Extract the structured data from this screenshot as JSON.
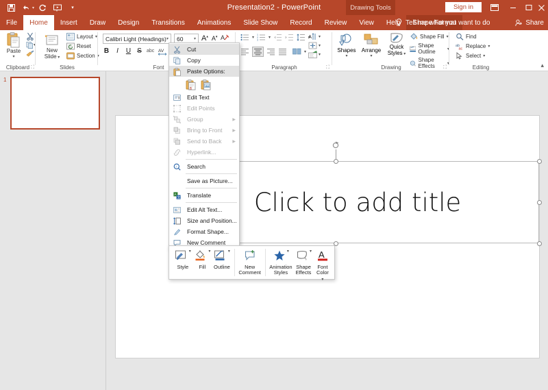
{
  "window": {
    "title": "Presentation2  -  PowerPoint",
    "contextual_tab_group": "Drawing Tools",
    "signin_label": "Sign in",
    "accent_color": "#b7472a",
    "contextual_tab_bg": "#a23b1f",
    "quick_access": [
      {
        "name": "save-icon",
        "glyph": "⬚"
      },
      {
        "name": "undo-icon",
        "glyph": "↶"
      },
      {
        "name": "redo-icon",
        "glyph": "↻"
      },
      {
        "name": "start-from-beginning-icon",
        "glyph": "⬜"
      },
      {
        "name": "customize-qat-icon",
        "glyph": "⌄"
      }
    ],
    "controls": {
      "ribbon_display": "⬒",
      "minimize": "–",
      "maximize": "☐",
      "close": "✕"
    }
  },
  "tabs": [
    {
      "label": "File",
      "active": false,
      "contextual": false
    },
    {
      "label": "Home",
      "active": true,
      "contextual": false
    },
    {
      "label": "Insert",
      "active": false,
      "contextual": false
    },
    {
      "label": "Draw",
      "active": false,
      "contextual": false
    },
    {
      "label": "Design",
      "active": false,
      "contextual": false
    },
    {
      "label": "Transitions",
      "active": false,
      "contextual": false
    },
    {
      "label": "Animations",
      "active": false,
      "contextual": false
    },
    {
      "label": "Slide Show",
      "active": false,
      "contextual": false
    },
    {
      "label": "Record",
      "active": false,
      "contextual": false
    },
    {
      "label": "Review",
      "active": false,
      "contextual": false
    },
    {
      "label": "View",
      "active": false,
      "contextual": false
    },
    {
      "label": "Help",
      "active": false,
      "contextual": false
    },
    {
      "label": "Shape Format",
      "active": false,
      "contextual": true
    }
  ],
  "tellme": {
    "label": "Tell me what you want to do",
    "icon": "lightbulb-icon"
  },
  "share": {
    "label": "Share",
    "icon": "share-person-icon"
  },
  "ribbon": {
    "groups": [
      {
        "name": "Clipboard"
      },
      {
        "name": "Slides"
      },
      {
        "name": "Font"
      },
      {
        "name": "Paragraph"
      },
      {
        "name": "Drawing"
      },
      {
        "name": "Editing"
      }
    ],
    "clipboard": {
      "paste_label": "Paste",
      "cut_tooltip": "Cut",
      "copy_tooltip": "Copy",
      "format_painter_tooltip": "Format Painter"
    },
    "slides": {
      "new_slide_label": "New\nSlide",
      "new_slide_line1": "New",
      "new_slide_line2": "Slide",
      "layout_label": "Layout",
      "reset_label": "Reset",
      "section_label": "Section"
    },
    "font": {
      "font_name": "Calibri Light (Headings)",
      "font_size": "60",
      "bold": "B",
      "italic": "I",
      "underline": "U",
      "strikethrough": "S",
      "shadow": "abc",
      "char_spacing": "AV",
      "grow_font": "A",
      "shrink_font": "A",
      "clear_formatting": "A"
    },
    "drawing": {
      "shapes_label": "Shapes",
      "arrange_label": "Arrange",
      "quick_styles_line1": "Quick",
      "quick_styles_line2": "Styles",
      "shape_fill_label": "Shape Fill",
      "shape_outline_label": "Shape Outline",
      "shape_effects_label": "Shape Effects"
    },
    "editing": {
      "find_label": "Find",
      "replace_label": "Replace",
      "select_label": "Select"
    }
  },
  "thumbnails": [
    {
      "number": "1"
    }
  ],
  "slide": {
    "title_placeholder": "Click to add title"
  },
  "context_menu": {
    "items": [
      {
        "label": "Cut",
        "icon": "scissors-icon",
        "disabled": false,
        "highlighted": true,
        "submenu": false,
        "separator_after": false
      },
      {
        "label": "Copy",
        "icon": "copy-icon",
        "disabled": false,
        "highlighted": false,
        "submenu": false,
        "separator_after": false
      },
      {
        "label": "Paste Options:",
        "icon": "paste-icon",
        "disabled": false,
        "highlighted": true,
        "submenu": false,
        "separator_after": false
      },
      {
        "label": "Edit Text",
        "icon": "edit-text-icon",
        "disabled": false,
        "highlighted": false,
        "submenu": false,
        "separator_after": false
      },
      {
        "label": "Edit Points",
        "icon": "edit-points-icon",
        "disabled": true,
        "highlighted": false,
        "submenu": false,
        "separator_after": false
      },
      {
        "label": "Group",
        "icon": "group-icon",
        "disabled": true,
        "highlighted": false,
        "submenu": true,
        "separator_after": false
      },
      {
        "label": "Bring to Front",
        "icon": "bring-to-front-icon",
        "disabled": true,
        "highlighted": false,
        "submenu": true,
        "separator_after": false
      },
      {
        "label": "Send to Back",
        "icon": "send-to-back-icon",
        "disabled": true,
        "highlighted": false,
        "submenu": true,
        "separator_after": false
      },
      {
        "label": "Hyperlink...",
        "icon": "hyperlink-icon",
        "disabled": true,
        "highlighted": false,
        "submenu": false,
        "separator_after": true
      },
      {
        "label": "Search",
        "icon": "search-icon",
        "disabled": false,
        "highlighted": false,
        "submenu": false,
        "separator_after": true
      },
      {
        "label": "Save as Picture...",
        "icon": "save-as-picture-icon",
        "disabled": false,
        "highlighted": false,
        "submenu": false,
        "separator_after": true
      },
      {
        "label": "Translate",
        "icon": "translate-icon",
        "disabled": false,
        "highlighted": false,
        "submenu": false,
        "separator_after": true
      },
      {
        "label": "Edit Alt Text...",
        "icon": "alt-text-icon",
        "disabled": false,
        "highlighted": false,
        "submenu": false,
        "separator_after": false
      },
      {
        "label": "Size and Position...",
        "icon": "size-position-icon",
        "disabled": false,
        "highlighted": false,
        "submenu": false,
        "separator_after": false
      },
      {
        "label": "Format Shape...",
        "icon": "format-shape-icon",
        "disabled": false,
        "highlighted": false,
        "submenu": false,
        "separator_after": false
      },
      {
        "label": "New Comment",
        "icon": "new-comment-icon",
        "disabled": false,
        "highlighted": false,
        "submenu": false,
        "separator_after": false
      }
    ],
    "paste_options": [
      {
        "name": "paste-keep-text-only-icon"
      },
      {
        "name": "paste-picture-icon"
      }
    ]
  },
  "mini_toolbar": {
    "items": [
      {
        "label1": "Style",
        "label2": "",
        "icon": "shape-style-icon",
        "dropdown": true
      },
      {
        "label1": "Fill",
        "label2": "",
        "icon": "fill-bucket-icon",
        "dropdown": true
      },
      {
        "label1": "Outline",
        "label2": "",
        "icon": "outline-pen-icon",
        "dropdown": true
      },
      {
        "label1": "New",
        "label2": "Comment",
        "icon": "new-comment-icon",
        "dropdown": false
      },
      {
        "label1": "Animation",
        "label2": "Styles",
        "icon": "animation-star-icon",
        "dropdown": true
      },
      {
        "label1": "Shape",
        "label2": "Effects",
        "icon": "shape-effects-icon",
        "dropdown": true
      },
      {
        "label1": "Font",
        "label2": "Color",
        "icon": "font-color-icon",
        "dropdown": true
      }
    ]
  }
}
